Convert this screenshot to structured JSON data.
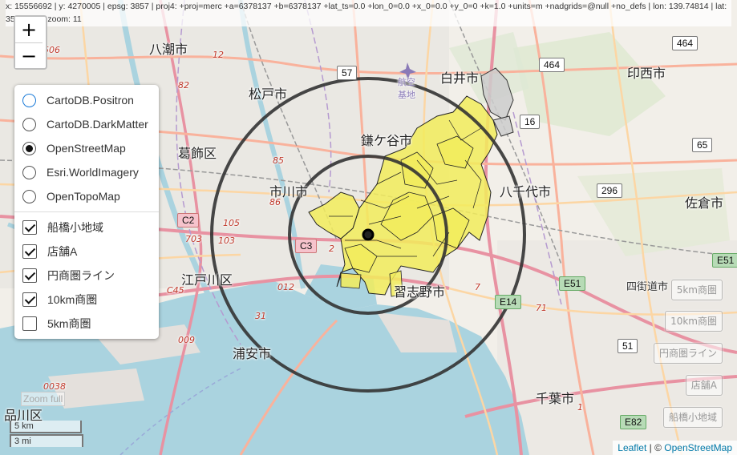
{
  "coords": {
    "text": "x: 15556692 | y: 4270005 | epsg: 3857 | proj4: +proj=merc +a=6378137 +b=6378137 +lat_ts=0.0 +lon_0=0.0 +x_0=0.0 +y_0=0 +k=1.0 +units=m +nadgrids=@null +no_defs | lon: 139.74814 | lat: 35.71718 | zoom: 11"
  },
  "zoom": {
    "in_label": "+",
    "out_label": "−"
  },
  "layers": {
    "base": [
      {
        "label": "CartoDB.Positron",
        "selected": false
      },
      {
        "label": "CartoDB.DarkMatter",
        "selected": false
      },
      {
        "label": "OpenStreetMap",
        "selected": true
      },
      {
        "label": "Esri.WorldImagery",
        "selected": false
      },
      {
        "label": "OpenTopoMap",
        "selected": false
      }
    ],
    "overlays": [
      {
        "label": "船橋小地域",
        "checked": true
      },
      {
        "label": "店舗A",
        "checked": true
      },
      {
        "label": "円商圏ライン",
        "checked": true
      },
      {
        "label": "10km商圏",
        "checked": true
      },
      {
        "label": "5km商圏",
        "checked": false
      }
    ]
  },
  "easy_buttons": {
    "b5km": "5km商圏",
    "b10km": "10km商圏",
    "bcircle": "円商圏ライン",
    "bstore": "店舗A",
    "bfunabashi": "船橋小地域"
  },
  "zoom_full": "Zoom full",
  "scale": {
    "km": "5 km",
    "mi": "3 mi"
  },
  "attribution": {
    "leaflet": "Leaflet",
    "sep": " | © ",
    "osm": "OpenStreetMap"
  },
  "labels": {
    "yashio": "八潮市",
    "matsudo": "松戸市",
    "shiroi": "白井市",
    "inzai": "印西市",
    "katsushika": "葛飾区",
    "kamagaya": "鎌ケ谷市",
    "ichikawa": "市川市",
    "yachiyo": "八千代市",
    "sakura": "佐倉市",
    "edogawa": "江戸川区",
    "narashino": "習志野市",
    "yotsukaido": "四街道市",
    "urayasu": "浦安市",
    "chiba": "千葉市",
    "shinagawa": "品川区",
    "airport": "航空",
    "kichi": "基地"
  },
  "shields": {
    "r57": "57",
    "r16": "16",
    "r464a": "464",
    "r464b": "464",
    "r65": "65",
    "r296": "296",
    "rE51a": "E51",
    "rE51b": "E51",
    "rE14": "E14",
    "r51": "51",
    "rC2": "C2",
    "rC3": "C3",
    "rE82": "E82",
    "r1": "1"
  },
  "road_numbers": {
    "n506": "506",
    "n12": "12",
    "n82": "82",
    "n85": "85",
    "n86": "86",
    "n105": "105",
    "n103": "103",
    "n703": "703",
    "n2": "2",
    "nC45": "C45",
    "n012": "012",
    "n31": "31",
    "n009": "009",
    "n0038": "0038",
    "n7": "7",
    "n71": "71"
  },
  "colors": {
    "water": "#aad3df",
    "land": "#f2efe9",
    "urban": "#e0dfdf",
    "motorway": "#e892a2",
    "trunk": "#f9b29c",
    "primary": "#fcd6a4",
    "area_fill": "#f2ec5c",
    "ring": "#333333"
  }
}
